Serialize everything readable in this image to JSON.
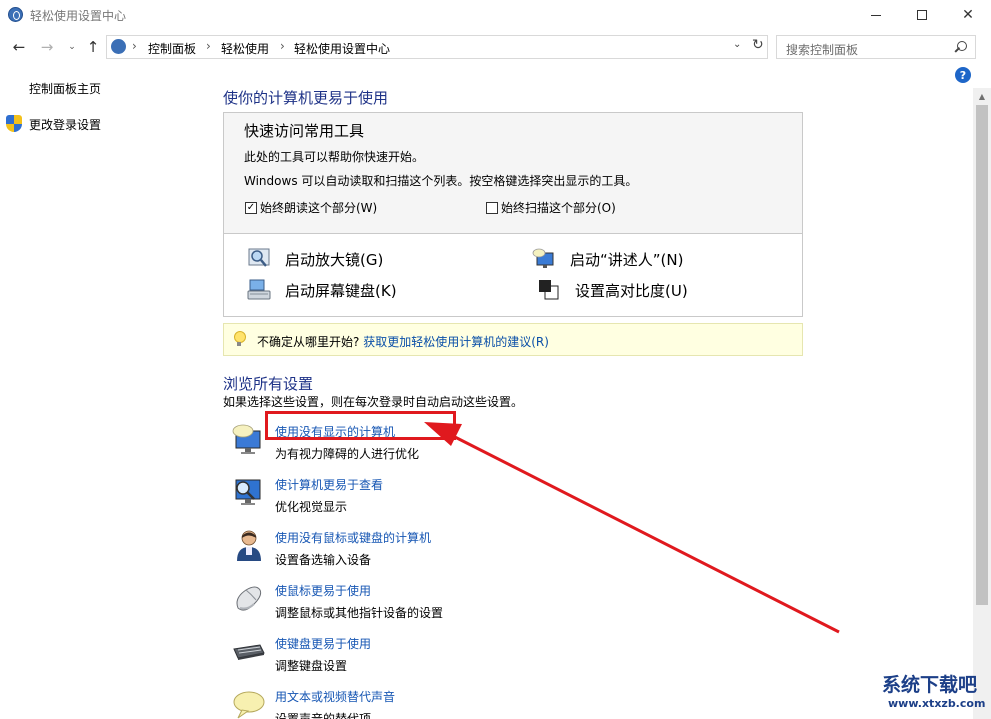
{
  "window": {
    "title": "轻松使用设置中心",
    "min": "",
    "max": "",
    "close": "✕"
  },
  "nav": {
    "back": "←",
    "forward": "→",
    "recent": "⌄",
    "up": "↑",
    "breadcrumb": [
      "控制面板",
      "轻松使用",
      "轻松使用设置中心"
    ],
    "separator": "›",
    "dropdown": "⌄",
    "refresh": "↻",
    "search_placeholder": "搜索控制面板"
  },
  "sidebar": {
    "home": "控制面板主页",
    "change_login": "更改登录设置"
  },
  "help": "?",
  "main": {
    "title": "使你的计算机更易于使用",
    "quick_access": {
      "heading": "快速访问常用工具",
      "line1": "此处的工具可以帮助你快速开始。",
      "line2": "Windows 可以自动读取和扫描这个列表。按空格键选择突出显示的工具。",
      "check_read": {
        "label": "始终朗读这个部分(W)",
        "checked": true,
        "mark": "✓"
      },
      "check_scan": {
        "label": "始终扫描这个部分(O)",
        "checked": false,
        "mark": ""
      }
    },
    "tools": {
      "magnifier": "启动放大镜(G)",
      "narrator": "启动“讲述人”(N)",
      "osk": "启动屏幕键盘(K)",
      "contrast": "设置高对比度(U)"
    },
    "tip": {
      "text": "不确定从哪里开始?",
      "link": "获取更加轻松使用计算机的建议(R)"
    },
    "browse": {
      "title": "浏览所有设置",
      "desc": "如果选择这些设置，则在每次登录时自动启动这些设置。",
      "items": [
        {
          "link": "使用没有显示的计算机",
          "desc": "为有视力障碍的人进行优化"
        },
        {
          "link": "使计算机更易于查看",
          "desc": "优化视觉显示"
        },
        {
          "link": "使用没有鼠标或键盘的计算机",
          "desc": "设置备选输入设备"
        },
        {
          "link": "使鼠标更易于使用",
          "desc": "调整鼠标或其他指针设备的设置"
        },
        {
          "link": "使键盘更易于使用",
          "desc": "调整键盘设置"
        },
        {
          "link": "用文本或视频替代声音",
          "desc": "设置声音的替代项"
        }
      ]
    }
  },
  "annotation": {
    "color": "#e0191e"
  },
  "watermark": {
    "title": "系统下载吧",
    "url": "www.xtxzb.com"
  },
  "colors": {
    "link": "#1656b3",
    "heading": "#1e3287",
    "tip_bg": "#ffffe1"
  }
}
